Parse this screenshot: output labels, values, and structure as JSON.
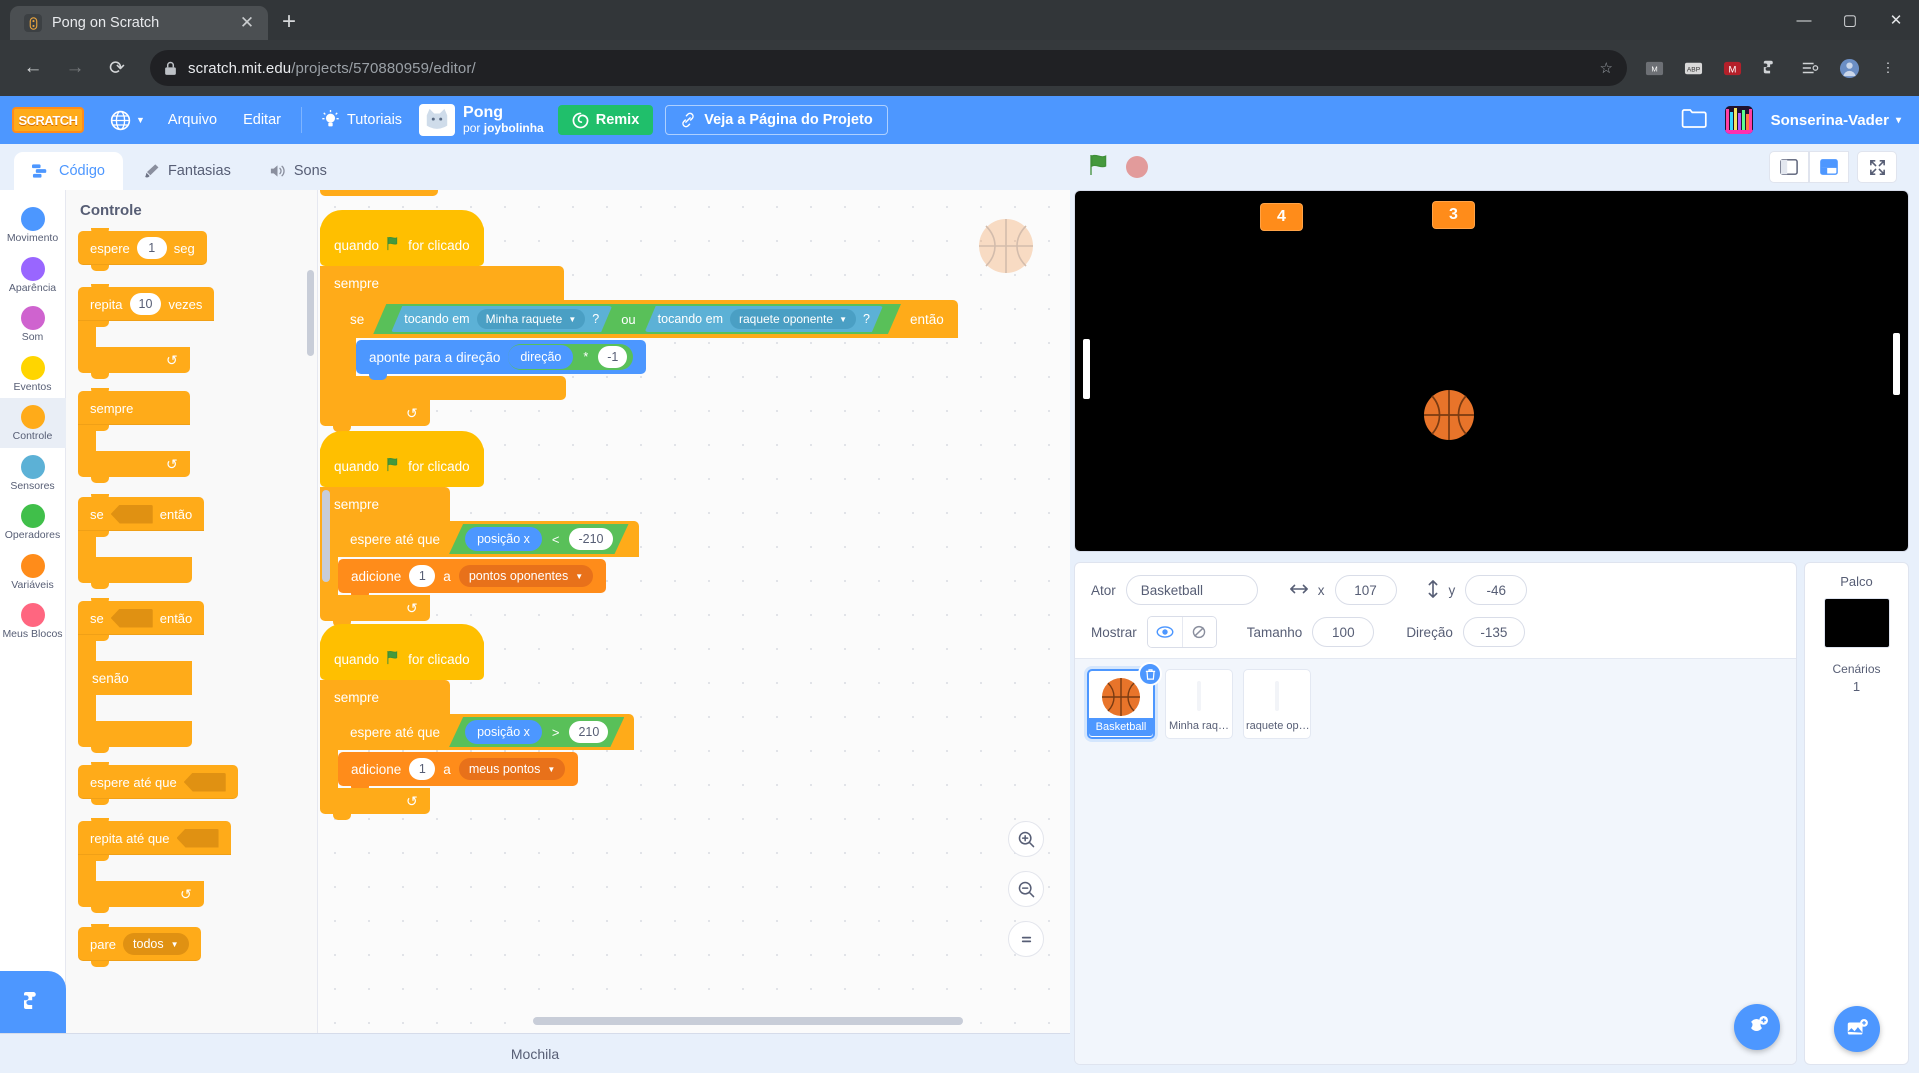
{
  "browser": {
    "tab_title": "Pong on Scratch",
    "tab_close": "✕",
    "new_tab": "+",
    "url_display": "scratch.mit.edu",
    "url_path": "/projects/570880959/editor/",
    "back": "←",
    "forward": "→",
    "reload": "⟳",
    "window": {
      "minimize": "—",
      "maximize": "▢",
      "close": "✕"
    }
  },
  "menubar": {
    "logo": "SCRATCH",
    "language": "globe-icon",
    "file": "Arquivo",
    "edit": "Editar",
    "tutorials": "Tutoriais",
    "project_name": "Pong",
    "project_author_prefix": "por",
    "project_author": "joybolinha",
    "remix": "Remix",
    "see_project_page": "Veja a Página do Projeto",
    "username": "Sonserina-Vader",
    "username_caret": "▾"
  },
  "editor_tabs": [
    {
      "label": "Código",
      "icon": "code-icon",
      "active": true
    },
    {
      "label": "Fantasias",
      "icon": "brush-icon",
      "active": false
    },
    {
      "label": "Sons",
      "icon": "speaker-icon",
      "active": false
    }
  ],
  "categories": [
    {
      "label": "Movimento",
      "color": "#4c97ff",
      "selected": false
    },
    {
      "label": "Aparência",
      "color": "#9966ff",
      "selected": false
    },
    {
      "label": "Som",
      "color": "#cf63cf",
      "selected": false
    },
    {
      "label": "Eventos",
      "color": "#ffd500",
      "selected": false
    },
    {
      "label": "Controle",
      "color": "#ffab19",
      "selected": true
    },
    {
      "label": "Sensores",
      "color": "#5cb1d6",
      "selected": false
    },
    {
      "label": "Operadores",
      "color": "#40bf4a",
      "selected": false
    },
    {
      "label": "Variáveis",
      "color": "#ff8c1a",
      "selected": false
    },
    {
      "label": "Meus Blocos",
      "color": "#ff6680",
      "selected": false
    }
  ],
  "palette": {
    "title": "Controle",
    "blocks": {
      "wait": {
        "pre": "espere",
        "value": "1",
        "post": "seg"
      },
      "repeat": {
        "pre": "repita",
        "value": "10",
        "post": "vezes"
      },
      "forever": {
        "label": "sempre"
      },
      "if_then": {
        "pre": "se",
        "post": "então"
      },
      "if_else": {
        "pre": "se",
        "post": "então",
        "else": "senão"
      },
      "wait_until": {
        "label": "espere até que"
      },
      "repeat_until": {
        "label": "repita até que"
      },
      "stop": {
        "label": "pare",
        "option": "todos"
      }
    }
  },
  "scripts": [
    {
      "hat": {
        "pre": "quando",
        "icon": "green-flag-icon",
        "post": "for clicado"
      },
      "forever_label": "sempre",
      "if_label": "se",
      "then_label": "então",
      "condition": {
        "operator": "ou",
        "left": {
          "label": "tocando em",
          "target": "Minha raquete",
          "q": "?"
        },
        "right": {
          "label": "tocando em",
          "target": "raquete oponente",
          "q": "?"
        }
      },
      "body": {
        "label": "aponte  para a direção",
        "reporter": "direção",
        "op": "*",
        "value": "-1"
      }
    },
    {
      "hat": {
        "pre": "quando",
        "icon": "green-flag-icon",
        "post": "for clicado"
      },
      "forever_label": "sempre",
      "wait_until_label": "espere até que",
      "comparison": {
        "reporter": "posição x",
        "op": "<",
        "value": "-210"
      },
      "change_var": {
        "pre": "adicione",
        "value": "1",
        "mid": "a",
        "variable": "pontos oponentes"
      }
    },
    {
      "hat": {
        "pre": "quando",
        "icon": "green-flag-icon",
        "post": "for clicado"
      },
      "forever_label": "sempre",
      "wait_until_label": "espere até que",
      "comparison": {
        "reporter": "posição x",
        "op": ">",
        "value": "210"
      },
      "change_var": {
        "pre": "adicione",
        "value": "1",
        "mid": "a",
        "variable": "meus pontos"
      }
    }
  ],
  "canvas": {
    "zoom_in": "zoom-in-icon",
    "zoom_out": "zoom-out-icon",
    "zoom_reset": "zoom-reset-icon"
  },
  "backpack": {
    "label": "Mochila"
  },
  "stage": {
    "green_flag": "green-flag-icon",
    "stop": "stop-icon",
    "monitors": [
      {
        "value": "4"
      },
      {
        "value": "3"
      }
    ],
    "background_color": "#000000"
  },
  "sprite_info": {
    "name_label": "Ator",
    "name_value": "Basketball",
    "x_label": "x",
    "x_value": "107",
    "y_label": "y",
    "y_value": "-46",
    "show_label": "Mostrar",
    "size_label": "Tamanho",
    "size_value": "100",
    "direction_label": "Direção",
    "direction_value": "-135"
  },
  "sprites": [
    {
      "name": "Basketball",
      "selected": true,
      "thumb": "basketball"
    },
    {
      "name": "Minha raq…",
      "selected": false,
      "thumb": "paddle"
    },
    {
      "name": "raquete op…",
      "selected": false,
      "thumb": "paddle"
    }
  ],
  "stage_panel": {
    "title": "Palco",
    "backdrops_label": "Cenários",
    "backdrops_count": "1"
  },
  "colors": {
    "scratch_blue": "#4d97ff",
    "control_orange": "#ffab19",
    "events_yellow": "#ffbf00",
    "motion_blue": "#4c97ff",
    "operator_green": "#59c059",
    "sensing_blue": "#5cb1d6",
    "variable_orange": "#ff8c1a",
    "remix_green": "#20bf6b"
  }
}
